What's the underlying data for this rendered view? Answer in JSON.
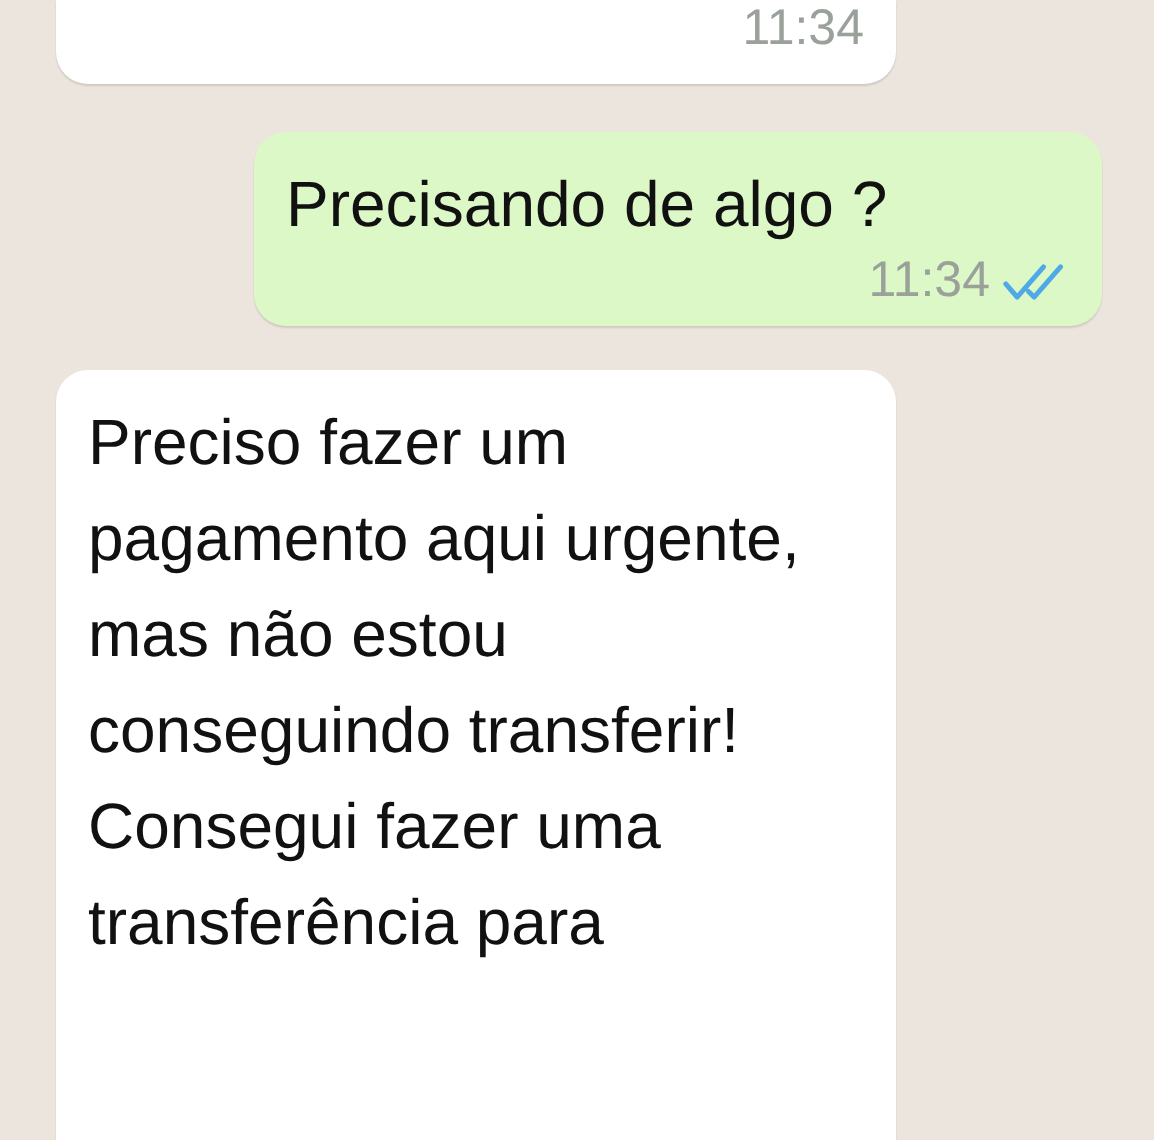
{
  "messages": [
    {
      "kind": "incoming",
      "time": "11:34"
    },
    {
      "kind": "outgoing",
      "text": "Precisando de algo ?",
      "time": "11:34",
      "read": true
    },
    {
      "kind": "incoming",
      "text": "Preciso fazer um pagamento aqui urgente, mas não estou conseguindo transferir! Consegui fazer uma transferência para"
    }
  ]
}
